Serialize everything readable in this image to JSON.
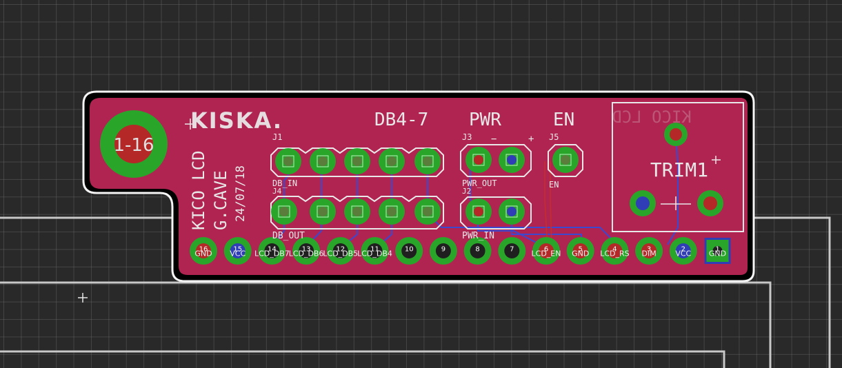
{
  "board": {
    "logo": "KISKA.",
    "title_vertical": "KICO LCD",
    "author_vertical": "G.CAVE",
    "date_vertical": "24/07/18",
    "ghost_text": "KICO LCD",
    "mount_hole_label": "1-16",
    "colors": {
      "background": "#292929",
      "board_fill": "#b02452",
      "pad_green": "#29a62a",
      "pad_red": "#b42828",
      "pad_blue": "#2f3db7",
      "trace_blue": "#3b48d0",
      "silkscreen": "#e8e8e8"
    }
  },
  "headers": {
    "db_label": "DB4-7",
    "pwr_label": "PWR",
    "en_label": "EN",
    "db_in_label": "DB_IN",
    "db_out_label": "DB_OUT",
    "pwr_out_label": "PWR_OUT",
    "pwr_in_label": "PWR_IN",
    "en_sub_label": "EN",
    "minus": "−",
    "plus": "+",
    "j1": "J1",
    "j3": "J3",
    "j4": "J4",
    "j2": "J2",
    "j5": "J5"
  },
  "trimmer": {
    "ref": "TRIM1"
  },
  "lcd_pins": [
    {
      "num": "16",
      "label": "GND"
    },
    {
      "num": "15",
      "label": "VCC"
    },
    {
      "num": "14",
      "label": "LCD_DB7"
    },
    {
      "num": "13",
      "label": "LCD_DB6"
    },
    {
      "num": "12",
      "label": "LCD_DB5"
    },
    {
      "num": "11",
      "label": "LCD_DB4"
    },
    {
      "num": "10",
      "label": ""
    },
    {
      "num": "9",
      "label": ""
    },
    {
      "num": "8",
      "label": ""
    },
    {
      "num": "7",
      "label": ""
    },
    {
      "num": "6",
      "label": "LCD_EN"
    },
    {
      "num": "5",
      "label": "GND"
    },
    {
      "num": "4",
      "label": "LCD_RS"
    },
    {
      "num": "3",
      "label": "DIM"
    },
    {
      "num": "2",
      "label": "VCC"
    },
    {
      "num": "1",
      "label": "GND"
    }
  ],
  "pin_row_text": {
    "row_labels": "GND  VCC LCD_DB7LCD_DB6LCD_DB5LCD_DB4",
    "row_labels_right": "LCD_EN  GND  LCD_RS  DIM  VCC  GND"
  }
}
